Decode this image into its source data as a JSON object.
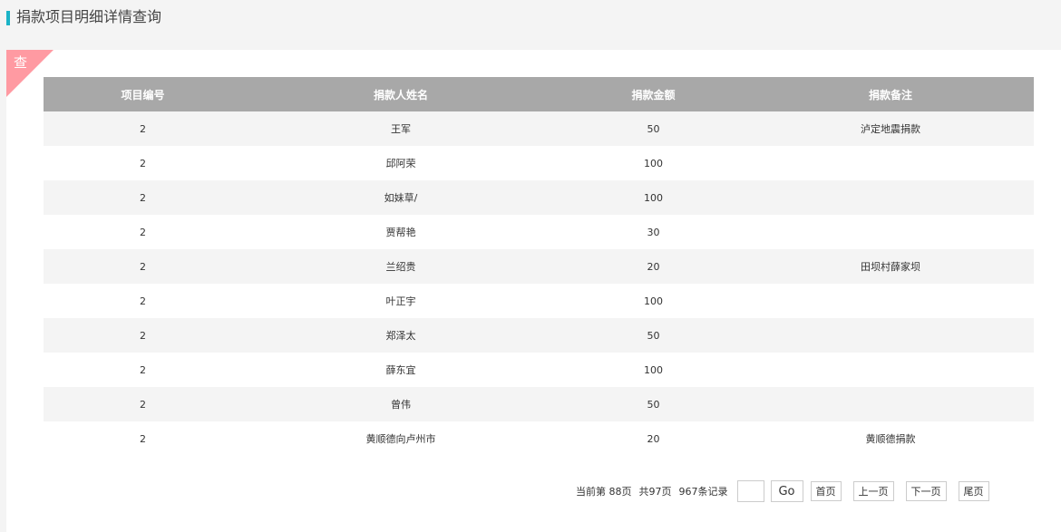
{
  "page": {
    "title": "捐款项目明细详情查询"
  },
  "panel": {
    "corner_label": "查"
  },
  "table": {
    "headers": [
      "项目编号",
      "捐款人姓名",
      "捐款金额",
      "捐款备注"
    ],
    "rows": [
      [
        "2",
        "王军",
        "50",
        "泸定地震捐款"
      ],
      [
        "2",
        "邱阿荣",
        "100",
        ""
      ],
      [
        "2",
        "如妹草/",
        "100",
        ""
      ],
      [
        "2",
        "贾帮艳",
        "30",
        ""
      ],
      [
        "2",
        "兰绍贵",
        "20",
        "田坝村薛家坝"
      ],
      [
        "2",
        "叶正宇",
        "100",
        ""
      ],
      [
        "2",
        "郑泽太",
        "50",
        ""
      ],
      [
        "2",
        "薛东宜",
        "100",
        ""
      ],
      [
        "2",
        "曾伟",
        "50",
        ""
      ],
      [
        "2",
        "黄顺德向卢州市",
        "20",
        "黄顺德捐款"
      ]
    ]
  },
  "pager": {
    "current_page": "当前第 88页",
    "total_pages": "共97页",
    "total_records": "967条记录",
    "page_input_value": "",
    "go_label": "Go",
    "first_label": "首页",
    "prev_label": "上一页",
    "next_label": "下一页",
    "last_label": "尾页"
  }
}
